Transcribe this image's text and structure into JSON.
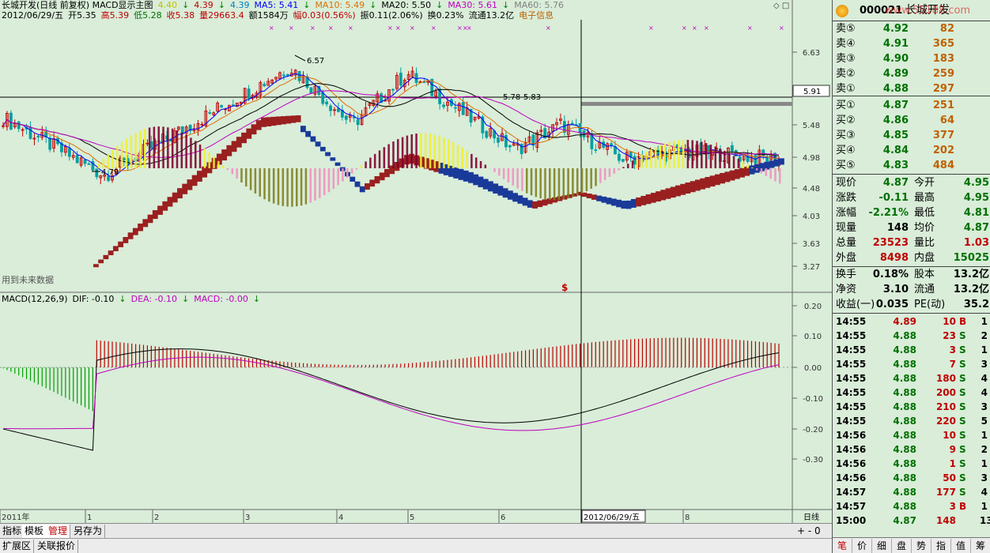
{
  "header": {
    "line1": {
      "title": "长城开发(日线 前复权) MACD显示主图",
      "v1": "4.40",
      "v2": "4.39",
      "v3": "4.39",
      "ma5": "MA5: 5.41",
      "ma10": "MA10: 5.49",
      "ma20": "MA20: 5.50",
      "ma30": "MA30: 5.61",
      "ma60": "MA60: 5.76"
    },
    "line2": {
      "date": "2012/06/29/五",
      "open": "开5.35",
      "high": "高5.39",
      "low": "低5.28",
      "close": "收5.38",
      "vol": "量29663.4",
      "amount": "额1584万",
      "change": "幅0.03(0.56%)",
      "swing": "振0.11(2.06%)",
      "turnover": "换0.23%",
      "float": "流通13.2亿",
      "sector": "电子信息"
    }
  },
  "main_chart": {
    "price_axis": [
      "6.63",
      "5.91",
      "5.48",
      "4.98",
      "4.48",
      "4.03",
      "3.63",
      "3.27"
    ],
    "current_price_tag": "5.91",
    "high_annot": "6.57",
    "low_annot": "4.79",
    "mid_annot": "5.78-5.83",
    "future_data_note": "用到未来数据",
    "signal_marker": "$"
  },
  "macd_panel": {
    "title": "MACD(12,26,9)",
    "dif": "DIF: -0.10",
    "dea": "DEA: -0.10",
    "macd": "MACD: -0.00",
    "axis": [
      "0.20",
      "0.10",
      "0.00",
      "-0.10",
      "-0.20",
      "-0.30"
    ]
  },
  "x_axis": {
    "labels": [
      "2011年",
      "1",
      "2",
      "3",
      "4",
      "5",
      "6",
      "8"
    ],
    "cursor_date": "2012/06/29/五",
    "period": "日线"
  },
  "quote": {
    "code": "000021",
    "name": "长城开发",
    "watermark": "www.55188.com",
    "sells": [
      {
        "label": "卖⑤",
        "price": "4.92",
        "vol": "82"
      },
      {
        "label": "卖④",
        "price": "4.91",
        "vol": "365"
      },
      {
        "label": "卖③",
        "price": "4.90",
        "vol": "183"
      },
      {
        "label": "卖②",
        "price": "4.89",
        "vol": "259"
      },
      {
        "label": "卖①",
        "price": "4.88",
        "vol": "297"
      }
    ],
    "buys": [
      {
        "label": "买①",
        "price": "4.87",
        "vol": "251"
      },
      {
        "label": "买②",
        "price": "4.86",
        "vol": "64"
      },
      {
        "label": "买③",
        "price": "4.85",
        "vol": "377"
      },
      {
        "label": "买④",
        "price": "4.84",
        "vol": "202"
      },
      {
        "label": "买⑤",
        "price": "4.83",
        "vol": "484"
      }
    ],
    "stats": [
      {
        "k1": "现价",
        "v1": "4.87",
        "c1": "grn",
        "k2": "今开",
        "v2": "4.95",
        "c2": "grn"
      },
      {
        "k1": "涨跌",
        "v1": "-0.11",
        "c1": "grn",
        "k2": "最高",
        "v2": "4.95",
        "c2": "grn"
      },
      {
        "k1": "涨幅",
        "v1": "-2.21%",
        "c1": "grn",
        "k2": "最低",
        "v2": "4.81",
        "c2": "grn"
      },
      {
        "k1": "现量",
        "v1": "148",
        "c1": "blk",
        "k2": "均价",
        "v2": "4.87",
        "c2": "grn"
      },
      {
        "k1": "总量",
        "v1": "23523",
        "c1": "red",
        "k2": "量比",
        "v2": "1.03",
        "c2": "red"
      },
      {
        "k1": "外盘",
        "v1": "8498",
        "c1": "red",
        "k2": "内盘",
        "v2": "15025",
        "c2": "grn"
      }
    ],
    "fund": [
      {
        "k1": "换手",
        "v1": "0.18%",
        "k2": "股本",
        "v2": "13.2亿"
      },
      {
        "k1": "净资",
        "v1": "3.10",
        "k2": "流通",
        "v2": "13.2亿"
      },
      {
        "k1": "收益(一)",
        "v1": "0.035",
        "k2": "PE(动)",
        "v2": "35.2"
      }
    ],
    "ticks": [
      {
        "time": "14:55",
        "price": "4.89",
        "vol": "10",
        "side": "B",
        "n": "1"
      },
      {
        "time": "14:55",
        "price": "4.88",
        "vol": "23",
        "side": "S",
        "n": "2"
      },
      {
        "time": "14:55",
        "price": "4.88",
        "vol": "3",
        "side": "S",
        "n": "1"
      },
      {
        "time": "14:55",
        "price": "4.88",
        "vol": "7",
        "side": "S",
        "n": "3"
      },
      {
        "time": "14:55",
        "price": "4.88",
        "vol": "180",
        "side": "S",
        "n": "4"
      },
      {
        "time": "14:55",
        "price": "4.88",
        "vol": "200",
        "side": "S",
        "n": "4"
      },
      {
        "time": "14:55",
        "price": "4.88",
        "vol": "210",
        "side": "S",
        "n": "3"
      },
      {
        "time": "14:55",
        "price": "4.88",
        "vol": "220",
        "side": "S",
        "n": "5"
      },
      {
        "time": "14:56",
        "price": "4.88",
        "vol": "10",
        "side": "S",
        "n": "1"
      },
      {
        "time": "14:56",
        "price": "4.88",
        "vol": "9",
        "side": "S",
        "n": "2"
      },
      {
        "time": "14:56",
        "price": "4.88",
        "vol": "1",
        "side": "S",
        "n": "1"
      },
      {
        "time": "14:56",
        "price": "4.88",
        "vol": "50",
        "side": "S",
        "n": "3"
      },
      {
        "time": "14:57",
        "price": "4.88",
        "vol": "177",
        "side": "S",
        "n": "4"
      },
      {
        "time": "14:57",
        "price": "4.88",
        "vol": "3",
        "side": "B",
        "n": "1"
      },
      {
        "time": "15:00",
        "price": "4.87",
        "vol": "148",
        "side": "",
        "n": "13"
      }
    ],
    "side_tabs": [
      "笔",
      "价",
      "细",
      "盘",
      "势",
      "指",
      "值",
      "筹"
    ]
  },
  "bottom_tabs": [
    "指标",
    "模板",
    "管理",
    "另存为"
  ],
  "status_tabs": [
    "扩展区",
    "关联报价"
  ],
  "colors": {
    "bg": "#d9edd9",
    "up": "#c00000",
    "down": "#008000",
    "ma5": "#0000ff",
    "ma10": "#e07000",
    "ma20": "#000000",
    "ma30": "#c000c0",
    "band_red": "#9a2020",
    "band_blue": "#1a3a9a",
    "bar_yellow": "#f0f030",
    "bar_pink": "#f090c0",
    "bar_olive": "#808020",
    "bar_maroon": "#800030"
  }
}
